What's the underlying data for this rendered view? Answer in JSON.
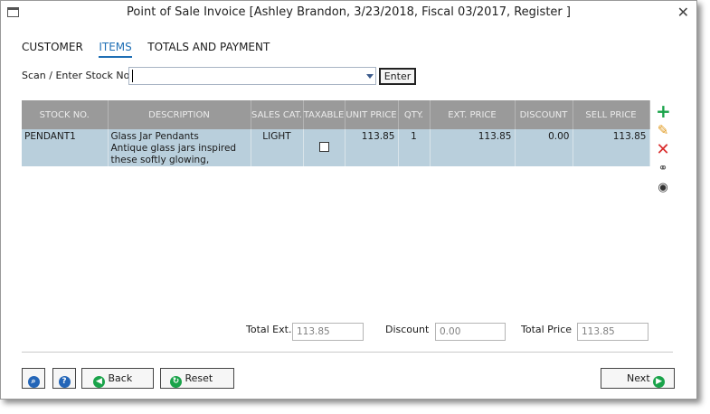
{
  "window": {
    "title": "Point of Sale Invoice [Ashley Brandon, 3/23/2018, Fiscal 03/2017, Register ]",
    "close_glyph": "✕"
  },
  "tabs": [
    {
      "label": "CUSTOMER",
      "active": false
    },
    {
      "label": "ITEMS",
      "active": true
    },
    {
      "label": "TOTALS AND PAYMENT",
      "active": false
    }
  ],
  "scan": {
    "label": "Scan / Enter Stock No.",
    "value": "",
    "enter_label": "Enter"
  },
  "grid": {
    "columns": [
      "STOCK NO.",
      "DESCRIPTION",
      "SALES CAT.",
      "TAXABLE",
      "UNIT PRICE",
      "QTY.",
      "EXT. PRICE",
      "DISCOUNT",
      "SELL PRICE"
    ],
    "rows": [
      {
        "stock_no": "PENDANT1",
        "description_line1": "Glass Jar Pendants",
        "description_line2": "Antique glass jars inspired",
        "description_line3": "these softly glowing,",
        "sales_cat": "LIGHT",
        "taxable": false,
        "unit_price": "113.85",
        "qty": "1",
        "ext_price": "113.85",
        "discount": "0.00",
        "sell_price": "113.85"
      }
    ]
  },
  "side_icons": {
    "add": "+",
    "edit": "✎",
    "delete": "✕",
    "find": "⚭",
    "view": "◉"
  },
  "totals": {
    "total_ext_label": "Total Ext.",
    "total_ext_value": "113.85",
    "discount_label": "Discount",
    "discount_value": "0.00",
    "total_price_label": "Total Price",
    "total_price_value": "113.85"
  },
  "buttons": {
    "back_label": "Back",
    "reset_label": "Reset",
    "next_label": "Next"
  },
  "colors": {
    "accent": "#1f6fb5",
    "header_bg": "#9a9a9a",
    "selected_row": "#b9cfdc",
    "add_green": "#1aa34a",
    "delete_red": "#d92b2b"
  }
}
